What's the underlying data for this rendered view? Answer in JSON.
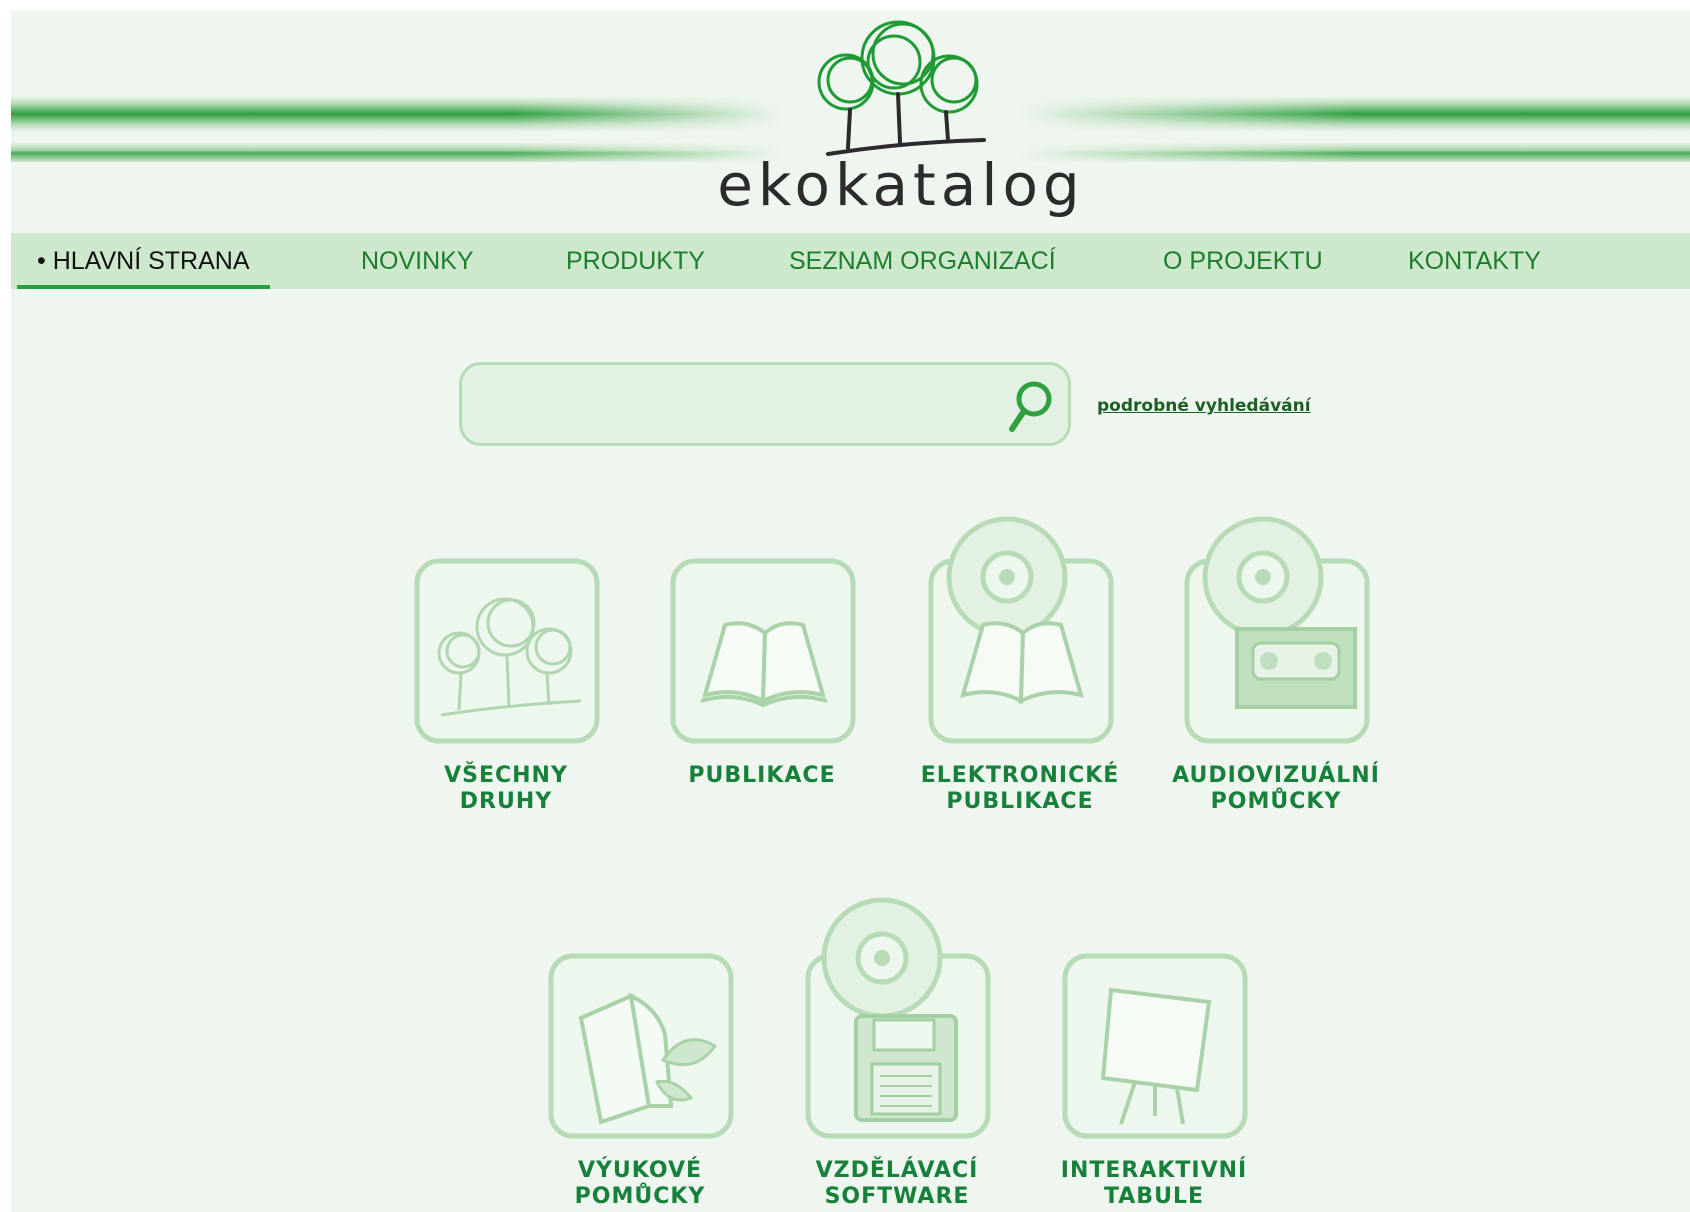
{
  "logo": {
    "text": "ekokatalog"
  },
  "nav": {
    "items": [
      {
        "label": "• HLAVNÍ STRANA",
        "active": true
      },
      {
        "label": "NOVINKY"
      },
      {
        "label": "PRODUKTY"
      },
      {
        "label": "SEZNAM ORGANIZACÍ"
      },
      {
        "label": "O PROJEKTU"
      },
      {
        "label": "KONTAKTY"
      }
    ]
  },
  "search": {
    "value": "",
    "placeholder": "",
    "icon": "search-icon",
    "advanced_link": "podrobné vyhledávání"
  },
  "categories": [
    {
      "line1": "VŠECHNY",
      "line2": "DRUHY",
      "icon": "trees-icon"
    },
    {
      "line1": "PUBLIKACE",
      "line2": "",
      "icon": "book-icon"
    },
    {
      "line1": "ELEKTRONICKÉ",
      "line2": "PUBLIKACE",
      "icon": "cd-book-icon"
    },
    {
      "line1": "AUDIOVIZUÁLNÍ",
      "line2": "POMŮCKY",
      "icon": "cd-cassette-icon"
    },
    {
      "line1": "VÝUKOVÉ",
      "line2": "POMŮCKY",
      "icon": "booklet-leaves-icon"
    },
    {
      "line1": "VZDĚLÁVACÍ",
      "line2": "SOFTWARE",
      "icon": "cd-floppy-icon"
    },
    {
      "line1": "INTERAKTIVNÍ",
      "line2": "TABULE",
      "icon": "whiteboard-icon"
    }
  ],
  "colors": {
    "brand_green": "#26a03a",
    "nav_bg": "#cde8cd",
    "page_bg": "#eff6ef",
    "label_green": "#17803a"
  }
}
